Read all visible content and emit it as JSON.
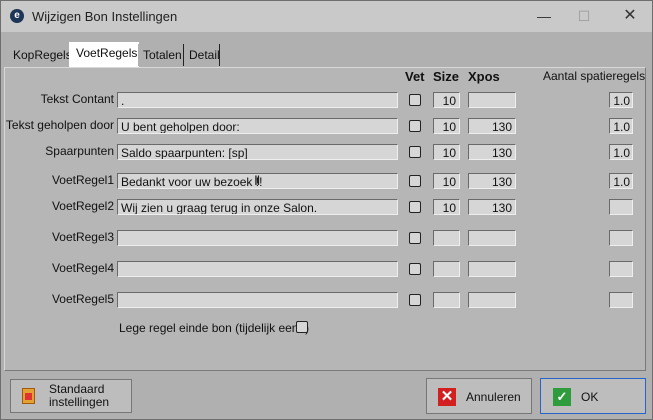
{
  "window": {
    "title": "Wijzigen Bon Instellingen"
  },
  "tabs": [
    {
      "label": "KopRegels",
      "active": false
    },
    {
      "label": "VoetRegels",
      "active": true
    },
    {
      "label": "Totalen",
      "active": false
    },
    {
      "label": "Detail",
      "active": false
    }
  ],
  "columns": {
    "vet": "Vet",
    "size": "Size",
    "xpos": "Xpos",
    "spatie": "Aantal spatieregels"
  },
  "rows": [
    {
      "label": "Tekst Contant",
      "text": ".",
      "vet": false,
      "size": "10",
      "xpos": "",
      "spatie": "1.0"
    },
    {
      "label": "Tekst geholpen door",
      "text": "U bent geholpen door:",
      "vet": false,
      "size": "10",
      "xpos": "130",
      "spatie": "1.0"
    },
    {
      "label": "Spaarpunten",
      "text": "Saldo spaarpunten: [sp]",
      "vet": false,
      "size": "10",
      "xpos": "130",
      "spatie": "1.0"
    },
    {
      "label": "VoetRegel1",
      "text": "Bedankt voor uw bezoek !!",
      "vet": false,
      "size": "10",
      "xpos": "130",
      "spatie": "1.0"
    },
    {
      "label": "VoetRegel2",
      "text": "Wij zien u graag terug in onze Salon.",
      "vet": false,
      "size": "10",
      "xpos": "130",
      "spatie": ""
    },
    {
      "label": "VoetRegel3",
      "text": "",
      "vet": false,
      "size": "",
      "xpos": "",
      "spatie": ""
    },
    {
      "label": "VoetRegel4",
      "text": "",
      "vet": false,
      "size": "",
      "xpos": "",
      "spatie": ""
    },
    {
      "label": "VoetRegel5",
      "text": "",
      "vet": false,
      "size": "",
      "xpos": "",
      "spatie": ""
    }
  ],
  "lege_regel": {
    "label": "Lege regel einde bon (tijdelijk een .)",
    "checked": false
  },
  "buttons": {
    "standaard_line1": "Standaard",
    "standaard_line2": "instellingen",
    "annuleren": "Annuleren",
    "ok": "OK"
  },
  "colors": {
    "ok_border": "#2a63c7",
    "cancel_icon": "#d21f1f",
    "ok_icon": "#2e9b3c"
  }
}
